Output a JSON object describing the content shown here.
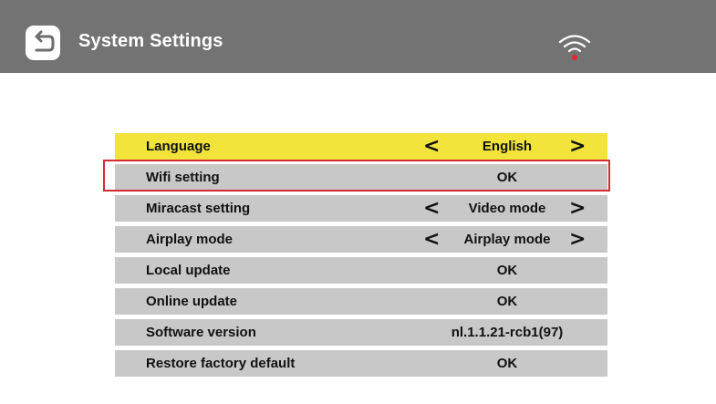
{
  "header": {
    "title": "System Settings",
    "back_icon": "back-arrow-icon",
    "wifi_icon": "wifi-icon",
    "wifi_dot_color": "#e8262f"
  },
  "colors": {
    "header_bg": "#737373",
    "selected_row": "#f2e43b",
    "row_bg": "#c8c8c8",
    "highlight_border": "#d82a35"
  },
  "settings": {
    "language": {
      "label": "Language",
      "value": "English",
      "prev": "<",
      "next": ">"
    },
    "wifi": {
      "label": "Wifi setting",
      "value": "OK"
    },
    "miracast": {
      "label": "Miracast setting",
      "value": "Video mode",
      "prev": "<",
      "next": ">"
    },
    "airplay": {
      "label": "Airplay mode",
      "value": "Airplay mode",
      "prev": "<",
      "next": ">"
    },
    "local_update": {
      "label": "Local update",
      "value": "OK"
    },
    "online_update": {
      "label": "Online update",
      "value": "OK"
    },
    "software_version": {
      "label": "Software version",
      "value": "nl.1.1.21-rcb1(97)"
    },
    "factory_default": {
      "label": "Restore factory default",
      "value": "OK"
    }
  }
}
